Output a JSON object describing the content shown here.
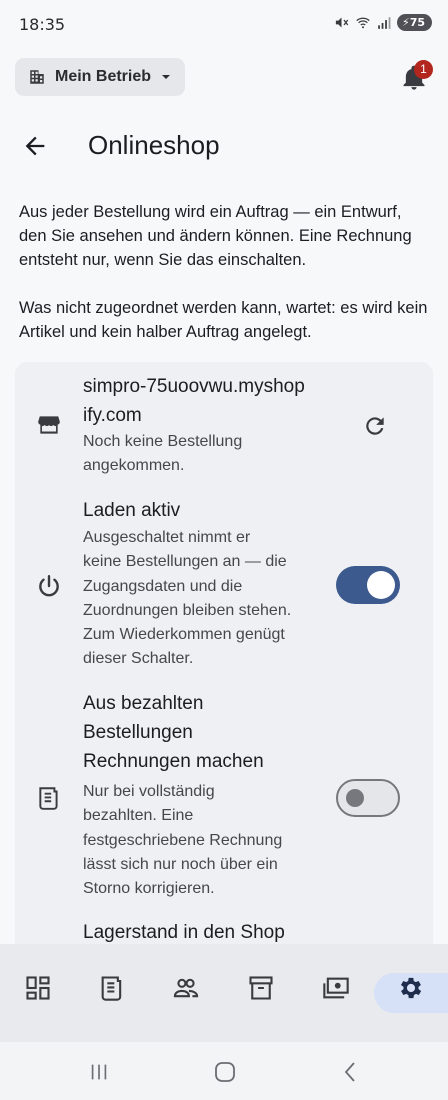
{
  "status_bar": {
    "time": "18:35",
    "battery": "75"
  },
  "header": {
    "business_select_label": "Mein Betrieb",
    "notification_count": "1"
  },
  "page": {
    "title": "Onlineshop",
    "intro_paragraph_1": "Aus jeder Bestellung wird ein Auftrag — ein Entwurf, den Sie ansehen und ändern können. Eine Rechnung entsteht nur, wenn Sie das einschalten.",
    "intro_paragraph_2": "Was nicht zugeordnet werden kann, wartet: es wird kein Artikel und kein halber Auftrag angelegt."
  },
  "shop": {
    "domain_line1": "simpro-75uoovwu.myshop",
    "domain_line2": "ify.com",
    "status_line1": "Noch keine Bestellung",
    "status_line2": "angekommen."
  },
  "settings": {
    "shop_active": {
      "title": "Laden aktiv",
      "desc": [
        "Ausgeschaltet nimmt er",
        "keine Bestellungen an — die",
        "Zugangsdaten und die",
        "Zuordnungen bleiben stehen.",
        "Zum Wiederkommen genügt",
        "dieser Schalter."
      ],
      "enabled": true
    },
    "paid_invoices": {
      "title": [
        "Aus bezahlten",
        "Bestellungen",
        "Rechnungen machen"
      ],
      "desc": [
        "Nur bei vollständig",
        "bezahlten. Eine",
        "festgeschriebene Rechnung",
        "lässt sich nur noch über ein",
        "Storno korrigieren."
      ],
      "enabled": false
    },
    "stock_sync": {
      "title": "Lagerstand in den Shop"
    }
  },
  "bottom_nav": {
    "items": [
      "dashboard-icon",
      "receipt-icon",
      "people-icon",
      "archive-icon",
      "payments-icon",
      "settings-icon"
    ],
    "active": "settings-icon"
  },
  "colors": {
    "accent": "#3c5a8d",
    "badge": "#b3261e",
    "active_pill": "#d6e0f6"
  }
}
